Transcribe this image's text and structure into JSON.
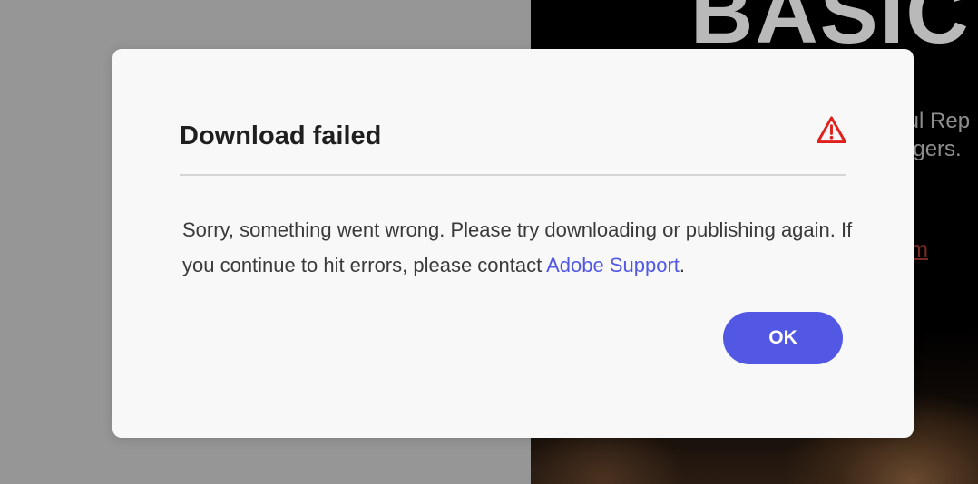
{
  "background": {
    "hero_text": "BASIC",
    "line_1": "ful Rep",
    "line_2": "ngers.",
    "link_text": "m"
  },
  "dialog": {
    "title": "Download failed",
    "icon": "alert-triangle-icon",
    "message_prefix": "Sorry, something went wrong. Please try downloading or publishing again. If you continue to hit errors, please contact ",
    "support_link": "Adobe Support",
    "message_suffix": ".",
    "ok_label": "OK"
  },
  "colors": {
    "accent": "#5258e4",
    "alert": "#e0201c",
    "dialog_bg": "#f8f8f8",
    "overlay": "#969696"
  }
}
